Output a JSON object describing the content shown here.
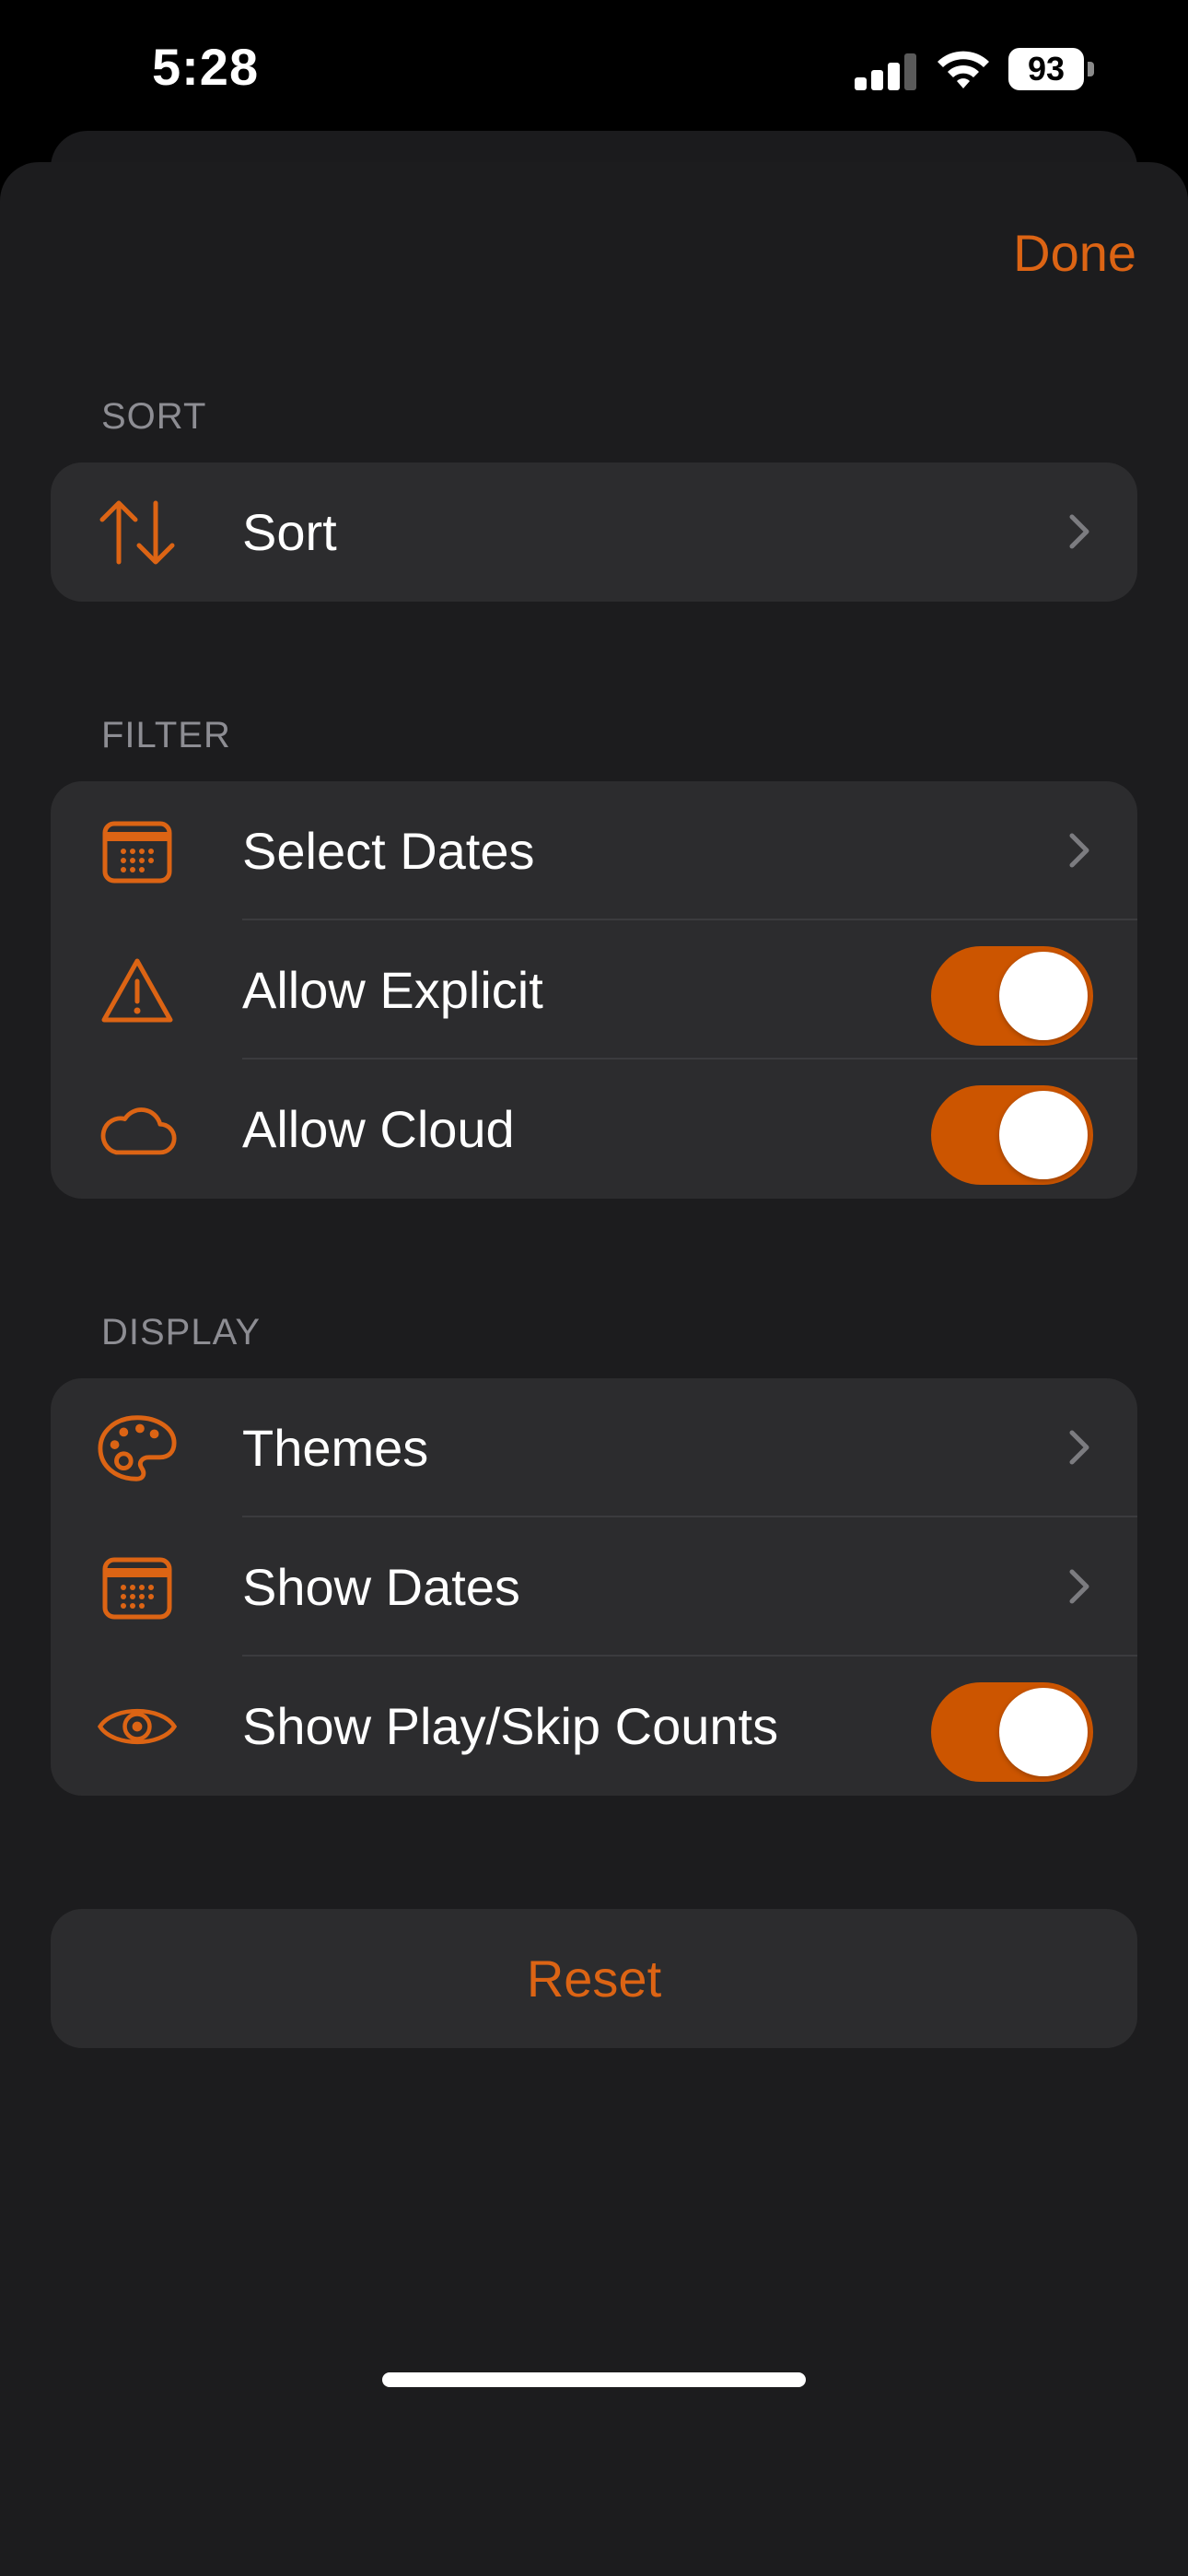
{
  "status_bar": {
    "time": "5:28",
    "battery": "93",
    "signal_bars": 3,
    "signal_total": 4
  },
  "header": {
    "done_label": "Done"
  },
  "sections": {
    "sort": {
      "heading": "SORT",
      "rows": [
        {
          "label": "Sort",
          "icon": "sort-arrows-icon",
          "accessory": "chevron"
        }
      ]
    },
    "filter": {
      "heading": "FILTER",
      "rows": [
        {
          "label": "Select Dates",
          "icon": "calendar-icon",
          "accessory": "chevron"
        },
        {
          "label": "Allow Explicit",
          "icon": "warning-triangle-icon",
          "accessory": "toggle",
          "on": true
        },
        {
          "label": "Allow Cloud",
          "icon": "cloud-icon",
          "accessory": "toggle",
          "on": true
        }
      ]
    },
    "display": {
      "heading": "DISPLAY",
      "rows": [
        {
          "label": "Themes",
          "icon": "palette-icon",
          "accessory": "chevron"
        },
        {
          "label": "Show Dates",
          "icon": "calendar-icon",
          "accessory": "chevron"
        },
        {
          "label": "Show Play/Skip Counts",
          "icon": "eye-icon",
          "accessory": "toggle",
          "on": true
        }
      ]
    }
  },
  "reset_label": "Reset",
  "colors": {
    "accent": "#dc6414",
    "toggle_on": "#cc5500",
    "background": "#1c1c1e",
    "cell": "#2c2c2e",
    "section_header": "#8d8d93"
  }
}
